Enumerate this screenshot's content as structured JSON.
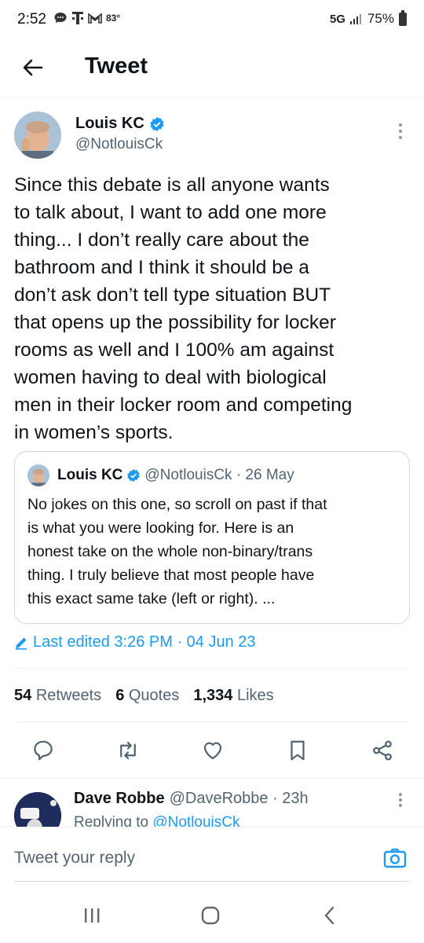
{
  "status_bar": {
    "time": "2:52",
    "temperature": "83°",
    "network": "5G",
    "battery": "75%"
  },
  "header": {
    "title": "Tweet",
    "back_icon": "arrow-left-icon"
  },
  "tweet": {
    "author_name": "Louis KC",
    "author_handle": "@NotlouisCk",
    "body": "Since this debate is all anyone wants\nto talk about, I want to add one more\nthing... I don’t really care about the\nbathroom and I think it should be a\ndon’t ask don’t tell type situation BUT\nthat opens up the possibility for locker\nrooms as well and I 100% am against\nwomen having to deal with biological\nmen in their locker room and competing\nin women’s sports.",
    "quote": {
      "author_name": "Louis KC",
      "handle_date": "@NotlouisCk · 26 May",
      "body": "No jokes on this one, so scroll on past if that\nis what you were looking for. Here is an\nhonest take on the whole non-binary/trans\nthing. I truly believe that most people have\nthis exact same take (left or right). ..."
    },
    "edited": "Last edited 3:26 PM · 04 Jun 23",
    "stats": {
      "retweets_count": "54",
      "retweets_label": "Retweets",
      "quotes_count": "6",
      "quotes_label": "Quotes",
      "likes_count": "1,334",
      "likes_label": "Likes"
    }
  },
  "reply_preview": {
    "author_name": "Dave Robbe",
    "meta": "@DaveRobbe · 23h",
    "replying_prefix": "Replying to",
    "replying_handle": "@NotlouisCk"
  },
  "compose": {
    "placeholder": "Tweet your reply"
  },
  "colors": {
    "accent": "#1d9bf0",
    "text": "#0f1419",
    "secondary": "#536471",
    "border": "#cfd9de"
  }
}
